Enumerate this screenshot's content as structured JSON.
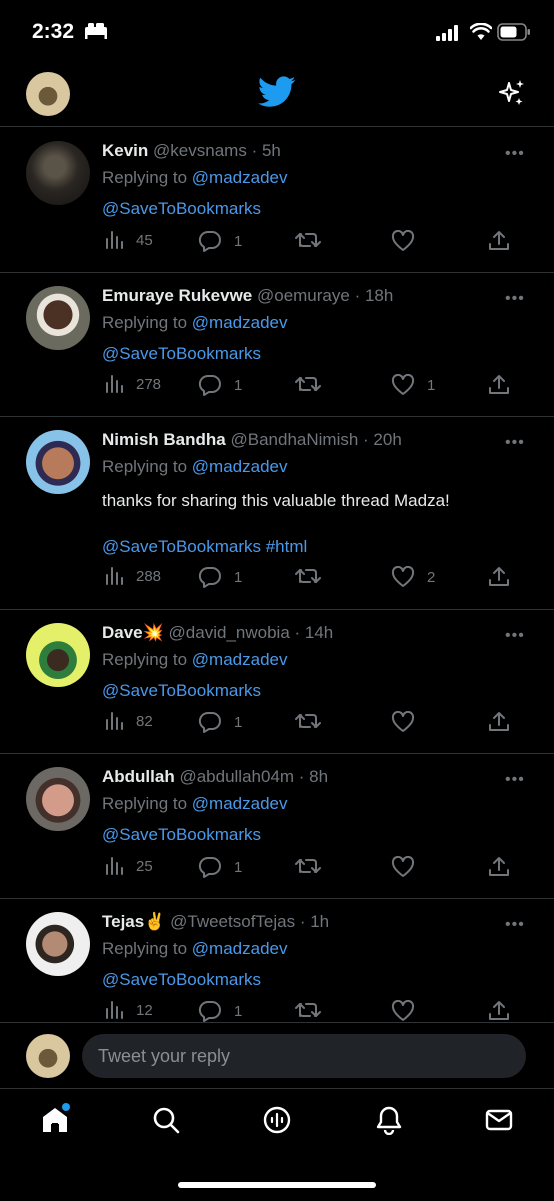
{
  "status_bar": {
    "time": "2:32",
    "icons": [
      "bed-icon",
      "signal-icon",
      "wifi-icon",
      "battery-icon"
    ]
  },
  "top_bar": {
    "logo": "twitter-bird-icon",
    "right_icon": "sparkle-icon",
    "brand_color": "#1d9bf0"
  },
  "replies": [
    {
      "name": "Kevin",
      "emoji": "",
      "handle": "@kevsnams",
      "time": "· 5h",
      "replying_prefix": "Replying to ",
      "replying_to": "@madzadev",
      "body": "",
      "mentions": "@SaveToBookmarks",
      "views": "45",
      "comments": "1",
      "retweets": "",
      "likes": ""
    },
    {
      "name": "Emuraye Rukevwe",
      "emoji": "",
      "handle": "@oemuraye",
      "time": "· 18h",
      "replying_prefix": "Replying to ",
      "replying_to": "@madzadev",
      "body": "",
      "mentions": "@SaveToBookmarks",
      "views": "278",
      "comments": "1",
      "retweets": "",
      "likes": "1"
    },
    {
      "name": "Nimish Bandha",
      "emoji": "",
      "handle": "@BandhaNimish",
      "time": "· 20h",
      "replying_prefix": "Replying to ",
      "replying_to": "@madzadev",
      "body": "thanks for sharing this valuable thread Madza!",
      "mentions": "@SaveToBookmarks #html",
      "views": "288",
      "comments": "1",
      "retweets": "",
      "likes": "2"
    },
    {
      "name": "Dave",
      "emoji": "💥",
      "handle": "@david_nwobia",
      "time": "· 14h",
      "replying_prefix": "Replying to ",
      "replying_to": "@madzadev",
      "body": "",
      "mentions": "@SaveToBookmarks",
      "views": "82",
      "comments": "1",
      "retweets": "",
      "likes": ""
    },
    {
      "name": "Abdullah",
      "emoji": "",
      "handle": "@abdullah04m",
      "time": "· 8h",
      "replying_prefix": "Replying to ",
      "replying_to": "@madzadev",
      "body": "",
      "mentions": "@SaveToBookmarks",
      "views": "25",
      "comments": "1",
      "retweets": "",
      "likes": ""
    },
    {
      "name": "Tejas",
      "emoji": "✌️",
      "handle": "@TweetsofTejas",
      "time": "· 1h",
      "replying_prefix": "Replying to ",
      "replying_to": "@madzadev",
      "body": "",
      "mentions": "@SaveToBookmarks",
      "views": "12",
      "comments": "1",
      "retweets": "",
      "likes": ""
    }
  ],
  "reply_bar": {
    "placeholder": "Tweet your reply"
  },
  "tab_bar": {
    "items": [
      "home-icon",
      "search-icon",
      "spaces-icon",
      "notifications-icon",
      "messages-icon"
    ],
    "active": "home-icon",
    "home_badge": true
  }
}
